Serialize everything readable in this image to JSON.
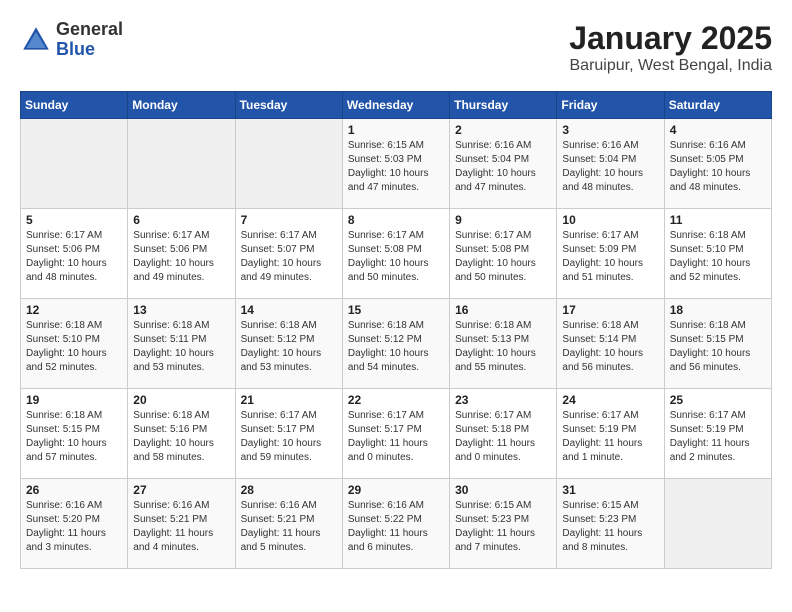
{
  "logo": {
    "general": "General",
    "blue": "Blue"
  },
  "title": "January 2025",
  "subtitle": "Baruipur, West Bengal, India",
  "weekdays": [
    "Sunday",
    "Monday",
    "Tuesday",
    "Wednesday",
    "Thursday",
    "Friday",
    "Saturday"
  ],
  "weeks": [
    [
      {
        "empty": true
      },
      {
        "empty": true
      },
      {
        "empty": true
      },
      {
        "day": 1,
        "sunrise": "6:15 AM",
        "sunset": "5:03 PM",
        "daylight": "10 hours and 47 minutes."
      },
      {
        "day": 2,
        "sunrise": "6:16 AM",
        "sunset": "5:04 PM",
        "daylight": "10 hours and 47 minutes."
      },
      {
        "day": 3,
        "sunrise": "6:16 AM",
        "sunset": "5:04 PM",
        "daylight": "10 hours and 48 minutes."
      },
      {
        "day": 4,
        "sunrise": "6:16 AM",
        "sunset": "5:05 PM",
        "daylight": "10 hours and 48 minutes."
      }
    ],
    [
      {
        "day": 5,
        "sunrise": "6:17 AM",
        "sunset": "5:06 PM",
        "daylight": "10 hours and 48 minutes."
      },
      {
        "day": 6,
        "sunrise": "6:17 AM",
        "sunset": "5:06 PM",
        "daylight": "10 hours and 49 minutes."
      },
      {
        "day": 7,
        "sunrise": "6:17 AM",
        "sunset": "5:07 PM",
        "daylight": "10 hours and 49 minutes."
      },
      {
        "day": 8,
        "sunrise": "6:17 AM",
        "sunset": "5:08 PM",
        "daylight": "10 hours and 50 minutes."
      },
      {
        "day": 9,
        "sunrise": "6:17 AM",
        "sunset": "5:08 PM",
        "daylight": "10 hours and 50 minutes."
      },
      {
        "day": 10,
        "sunrise": "6:17 AM",
        "sunset": "5:09 PM",
        "daylight": "10 hours and 51 minutes."
      },
      {
        "day": 11,
        "sunrise": "6:18 AM",
        "sunset": "5:10 PM",
        "daylight": "10 hours and 52 minutes."
      }
    ],
    [
      {
        "day": 12,
        "sunrise": "6:18 AM",
        "sunset": "5:10 PM",
        "daylight": "10 hours and 52 minutes."
      },
      {
        "day": 13,
        "sunrise": "6:18 AM",
        "sunset": "5:11 PM",
        "daylight": "10 hours and 53 minutes."
      },
      {
        "day": 14,
        "sunrise": "6:18 AM",
        "sunset": "5:12 PM",
        "daylight": "10 hours and 53 minutes."
      },
      {
        "day": 15,
        "sunrise": "6:18 AM",
        "sunset": "5:12 PM",
        "daylight": "10 hours and 54 minutes."
      },
      {
        "day": 16,
        "sunrise": "6:18 AM",
        "sunset": "5:13 PM",
        "daylight": "10 hours and 55 minutes."
      },
      {
        "day": 17,
        "sunrise": "6:18 AM",
        "sunset": "5:14 PM",
        "daylight": "10 hours and 56 minutes."
      },
      {
        "day": 18,
        "sunrise": "6:18 AM",
        "sunset": "5:15 PM",
        "daylight": "10 hours and 56 minutes."
      }
    ],
    [
      {
        "day": 19,
        "sunrise": "6:18 AM",
        "sunset": "5:15 PM",
        "daylight": "10 hours and 57 minutes."
      },
      {
        "day": 20,
        "sunrise": "6:18 AM",
        "sunset": "5:16 PM",
        "daylight": "10 hours and 58 minutes."
      },
      {
        "day": 21,
        "sunrise": "6:17 AM",
        "sunset": "5:17 PM",
        "daylight": "10 hours and 59 minutes."
      },
      {
        "day": 22,
        "sunrise": "6:17 AM",
        "sunset": "5:17 PM",
        "daylight": "11 hours and 0 minutes."
      },
      {
        "day": 23,
        "sunrise": "6:17 AM",
        "sunset": "5:18 PM",
        "daylight": "11 hours and 0 minutes."
      },
      {
        "day": 24,
        "sunrise": "6:17 AM",
        "sunset": "5:19 PM",
        "daylight": "11 hours and 1 minute."
      },
      {
        "day": 25,
        "sunrise": "6:17 AM",
        "sunset": "5:19 PM",
        "daylight": "11 hours and 2 minutes."
      }
    ],
    [
      {
        "day": 26,
        "sunrise": "6:16 AM",
        "sunset": "5:20 PM",
        "daylight": "11 hours and 3 minutes."
      },
      {
        "day": 27,
        "sunrise": "6:16 AM",
        "sunset": "5:21 PM",
        "daylight": "11 hours and 4 minutes."
      },
      {
        "day": 28,
        "sunrise": "6:16 AM",
        "sunset": "5:21 PM",
        "daylight": "11 hours and 5 minutes."
      },
      {
        "day": 29,
        "sunrise": "6:16 AM",
        "sunset": "5:22 PM",
        "daylight": "11 hours and 6 minutes."
      },
      {
        "day": 30,
        "sunrise": "6:15 AM",
        "sunset": "5:23 PM",
        "daylight": "11 hours and 7 minutes."
      },
      {
        "day": 31,
        "sunrise": "6:15 AM",
        "sunset": "5:23 PM",
        "daylight": "11 hours and 8 minutes."
      },
      {
        "empty": true
      }
    ]
  ]
}
